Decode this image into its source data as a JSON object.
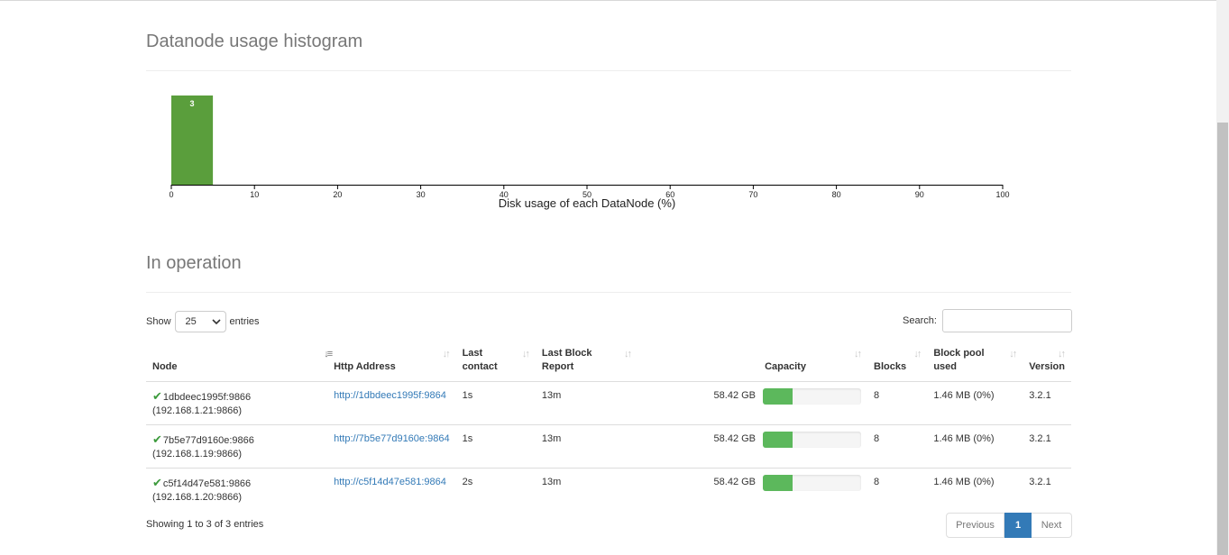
{
  "histogram": {
    "title": "Datanode usage histogram",
    "chart_data": {
      "type": "bar",
      "xlabel": "Disk usage of each DataNode (%)",
      "xlim": [
        0,
        100
      ],
      "xticks": [
        "0",
        "10",
        "20",
        "30",
        "40",
        "50",
        "60",
        "70",
        "80",
        "90",
        "100"
      ],
      "bins": [
        {
          "x0": 0,
          "x1": 5,
          "count": 3,
          "label": "3"
        }
      ],
      "bar_color": "#5a9e3c"
    }
  },
  "operation": {
    "title": "In operation",
    "show_label": "Show",
    "page_size": "25",
    "entries_label": "entries",
    "search_label": "Search:",
    "search_value": "",
    "columns": [
      {
        "label": "Node"
      },
      {
        "label": "Http Address"
      },
      {
        "label": "Last contact"
      },
      {
        "label": "Last Block Report"
      },
      {
        "label": "Capacity"
      },
      {
        "label": "Blocks"
      },
      {
        "label": "Block pool used"
      },
      {
        "label": "Version"
      }
    ],
    "rows": [
      {
        "node": "1dbdeec1995f:9866",
        "ip": "(192.168.1.21:9866)",
        "http": "http://1dbdeec1995f:9864",
        "last_contact": "1s",
        "last_block_report": "13m",
        "capacity": "58.42 GB",
        "capacity_used_pct": 30,
        "blocks": "8",
        "block_pool_used": "1.46 MB (0%)",
        "version": "3.2.1"
      },
      {
        "node": "7b5e77d9160e:9866",
        "ip": "(192.168.1.19:9866)",
        "http": "http://7b5e77d9160e:9864",
        "last_contact": "1s",
        "last_block_report": "13m",
        "capacity": "58.42 GB",
        "capacity_used_pct": 30,
        "blocks": "8",
        "block_pool_used": "1.46 MB (0%)",
        "version": "3.2.1"
      },
      {
        "node": "c5f14d47e581:9866",
        "ip": "(192.168.1.20:9866)",
        "http": "http://c5f14d47e581:9864",
        "last_contact": "2s",
        "last_block_report": "13m",
        "capacity": "58.42 GB",
        "capacity_used_pct": 30,
        "blocks": "8",
        "block_pool_used": "1.46 MB (0%)",
        "version": "3.2.1"
      }
    ],
    "info": "Showing 1 to 3 of 3 entries",
    "pagination": {
      "previous": "Previous",
      "current": "1",
      "next": "Next"
    }
  }
}
